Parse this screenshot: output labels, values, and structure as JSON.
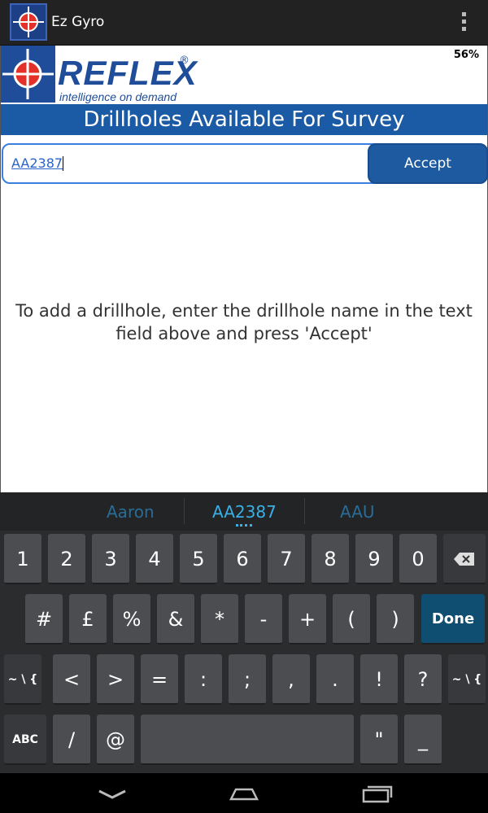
{
  "app": {
    "title": "Ez Gyro"
  },
  "status": {
    "battery": "56%"
  },
  "logo": {
    "name": "REFLEX",
    "registered": "®",
    "tagline": "intelligence on demand"
  },
  "header": {
    "title": "Drillholes Available For Survey"
  },
  "form": {
    "input_value": "AA2387",
    "accept_label": "Accept"
  },
  "instructions": {
    "line1": "To add a drillhole, enter the drillhole name in the text",
    "line2": "field above and press 'Accept'"
  },
  "keyboard": {
    "suggestions": [
      "Aaron",
      "AA2387",
      "AAU"
    ],
    "row1": [
      "1",
      "2",
      "3",
      "4",
      "5",
      "6",
      "7",
      "8",
      "9",
      "0"
    ],
    "row2": [
      "#",
      "£",
      "%",
      "&",
      "*",
      "-",
      "+",
      "(",
      ")"
    ],
    "row3": [
      "<",
      ">",
      "=",
      ":",
      ";",
      ",",
      ".",
      "!",
      "?"
    ],
    "row4": [
      "/",
      "@",
      "\"",
      "_"
    ],
    "alt_label": "~ \\ {",
    "abc_label": "ABC",
    "done_label": "Done"
  },
  "colors": {
    "accent": "#1b5aa4",
    "keyboard_bg": "#2a2c2e",
    "suggest_active": "#3ab0e6"
  }
}
